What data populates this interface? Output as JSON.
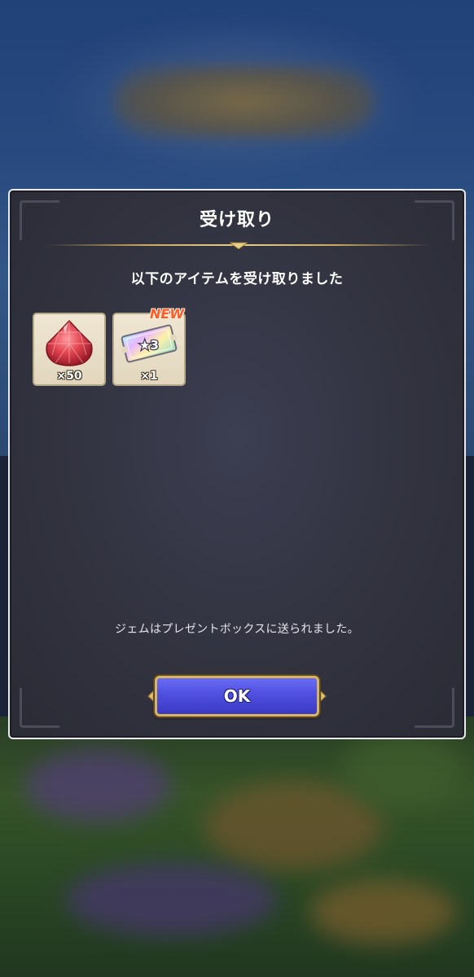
{
  "dialog": {
    "title": "受け取り",
    "subtitle": "以下のアイテムを受け取りました",
    "notice": "ジェムはプレゼントボックスに送られました。",
    "ok_label": "OK"
  },
  "items": [
    {
      "icon": "gem-icon",
      "quantity": "×50",
      "badge": ""
    },
    {
      "icon": "star-ticket-icon",
      "ticket_text": "★3",
      "quantity": "×1",
      "badge": "NEW"
    }
  ],
  "colors": {
    "dialog_bg": "#32333f",
    "dialog_border": "#e9e9ee",
    "gold_accent": "#c9a85c",
    "ok_button": "#4f4fe0",
    "new_badge": "#ff5a28",
    "gem": "#e0424d"
  }
}
